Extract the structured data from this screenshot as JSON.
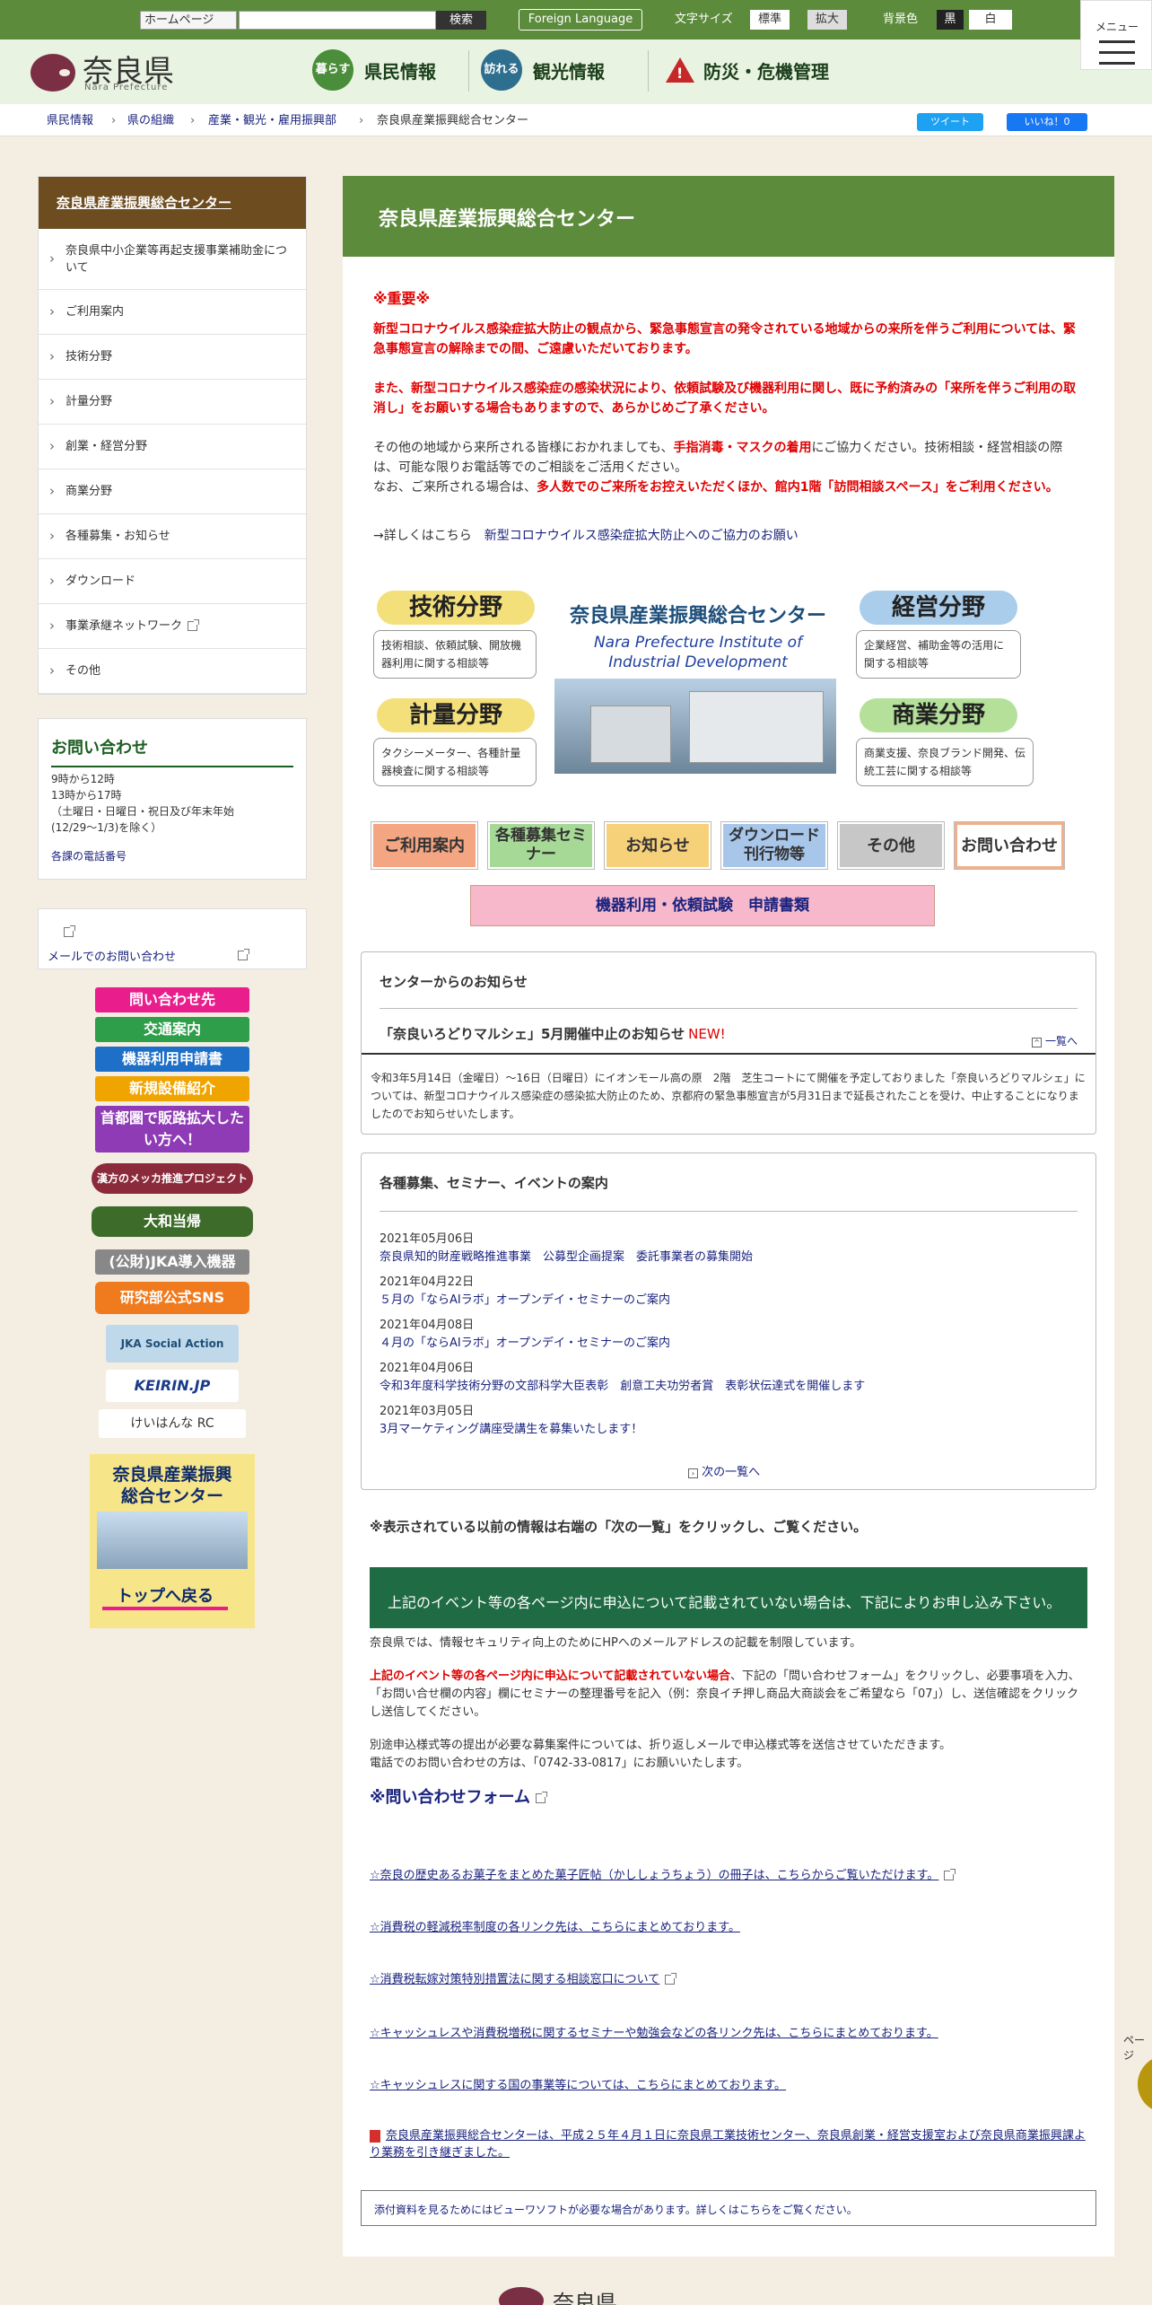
{
  "topbar": {
    "site_select": "ホームページ",
    "search_button": "検索",
    "foreign_language": "Foreign Language",
    "font_size_label": "文字サイズ",
    "font_standard": "標準",
    "font_large": "拡大",
    "bg_label": "背景色",
    "bg_black": "黒",
    "bg_white": "白",
    "menu": "メニュー"
  },
  "header": {
    "logo": "奈良県",
    "logo_sub": "Nara Prefecture",
    "nav": [
      {
        "icon": "暮らす",
        "label": "県民情報"
      },
      {
        "icon": "訪れる",
        "label": "観光情報"
      },
      {
        "icon": "!",
        "label": "防災・危機管理"
      }
    ]
  },
  "breadcrumb": [
    "県民情報",
    "県の組織",
    "産業・観光・雇用振興部",
    "奈良県産業振興総合センター"
  ],
  "social": {
    "tweet": "ツイート",
    "like": "いいね！0"
  },
  "sidebar": {
    "title": "奈良県産業振興総合センター",
    "items": [
      "奈良県中小企業等再起支援事業補助金について",
      "ご利用案内",
      "技術分野",
      "計量分野",
      "創業・経営分野",
      "商業分野",
      "各種募集・お知らせ",
      "ダウンロード",
      "事業承継ネットワーク",
      "その他"
    ]
  },
  "contact": {
    "title": "お問い合わせ",
    "hours1": "9時から12時",
    "hours2": "13時から17時",
    "hours3": "（土曜日・日曜日・祝日及び年末年始",
    "hours4": "(12/29～1/3)を除く）",
    "phone_link": "各課の電話番号",
    "mail_link": "メールでのお問い合わせ"
  },
  "banners": [
    "問い合わせ先",
    "交通案内",
    "機器利用申請書",
    "新規設備紹介",
    "首都圏で販路拡大したい方へ！",
    "漢方のメッカ推進プロジェクト",
    "大和当帰",
    "(公財)JKA導入機器",
    "研究部公式SNS",
    "JKA Social Action",
    "KEIRIN.JP",
    "けいはんな RC"
  ],
  "top_banner": {
    "line1": "奈良県産業振興",
    "line2": "総合センター",
    "button": "トップへ戻る"
  },
  "main": {
    "title": "奈良県産業振興総合センター",
    "important": "※重要※",
    "notice1": "新型コロナウイルス感染症拡大防止の観点から、緊急事態宣言の発令されている地域からの来所を伴うご利用については、緊急事態宣言の解除までの間、ご遠慮いただいております。",
    "notice2": "また、新型コロナウイルス感染症の感染状況により、依頼試験及び機器利用に関し、既に予約済みの「来所を伴うご利用の取消し」をお願いする場合もありますので、あらかじめご了承ください。",
    "notice3a": "その他の地域から来所される皆様におかれましても、",
    "notice3b": "手指消毒・マスクの着用",
    "notice3c": "にご協力ください。技術相談・経営相談の際は、可能な限りお電話等でのご相談をご活用ください。",
    "notice4a": "なお、ご来所される場合は、",
    "notice4b": "多人数でのご来所をお控えいただくほか、館内1階「訪問相談スペース」をご利用ください。",
    "more_prefix": "→詳しくはこちら",
    "more_link": "新型コロナウイルス感染症拡大防止へのご協力のお願い"
  },
  "fields": {
    "tech": {
      "title": "技術分野",
      "desc": "技術相談、依頼試験、開放機器利用に関する相談等"
    },
    "mgmt": {
      "title": "経営分野",
      "desc": "企業経営、補助金等の活用に関する相談等"
    },
    "meas": {
      "title": "計量分野",
      "desc": "タクシーメーター、各種計量器検査に関する相談等"
    },
    "comm": {
      "title": "商業分野",
      "desc": "商業支援、奈良ブランド開発、伝統工芸に関する相談等"
    },
    "center_jp": "奈良県産業振興総合センター",
    "center_en1": "Nara Prefecture Institute of",
    "center_en2": "Industrial Development"
  },
  "quicknav": [
    "ご利用案内",
    "各種募集セミナー",
    "お知らせ",
    "ダウンロード刊行物等",
    "その他",
    "お問い合わせ"
  ],
  "apply_button": "機器利用・依頼試験　申請書類",
  "news": {
    "title": "センターからのお知らせ",
    "item_title": "「奈良いろどりマルシェ」5月開催中止のお知らせ",
    "new": "NEW!",
    "list_link": "一覧へ",
    "body": "令和3年5月14日（金曜日）～16日（日曜日）にイオンモール高の原　2階　芝生コートにて開催を予定しておりました「奈良いろどりマルシェ」については、新型コロナウイルス感染症の感染拡大防止のため、京都府の緊急事態宣言が5月31日まで延長されたことを受け、中止することになりましたのでお知らせいたします。"
  },
  "events": {
    "title": "各種募集、セミナー、イベントの案内",
    "items": [
      {
        "date": "2021年05月06日",
        "text": "奈良県知的財産戦略推進事業　公募型企画提案　委託事業者の募集開始"
      },
      {
        "date": "2021年04月22日",
        "text": "５月の「ならAIラボ」オープンデイ・セミナーのご案内"
      },
      {
        "date": "2021年04月08日",
        "text": "４月の「ならAIラボ」オープンデイ・セミナーのご案内"
      },
      {
        "date": "2021年04月06日",
        "text": "令和3年度科学技術分野の文部科学大臣表彰　創意工夫功労者賞　表彰状伝達式を開催します"
      },
      {
        "date": "2021年03月05日",
        "text": "3月マーケティング講座受講生を募集いたします！"
      }
    ],
    "next_link": "次の一覧へ"
  },
  "note_prev": "※表示されている以前の情報は右端の「次の一覧」をクリックし、ご覧ください。",
  "apply_info": {
    "banner": "上記のイベント等の各ページ内に申込について記載されていない場合は、下記によりお申し込み下さい。",
    "p1": "奈良県では、情報セキュリティ向上のためにHPへのメールアドレスの記載を制限しています。",
    "p2a": "上記のイベント等の各ページ内に申込について記載されていない場合",
    "p2b": "、下記の「問い合わせフォーム」をクリックし、必要事項を入力、「お問い合せ欄の内容」欄にセミナーの整理番号を記入（例：奈良イチ押し商品大商談会をご希望なら「07」）し、送信確認をクリックし送信してください。",
    "p3": "別途申込様式等の提出が必要な募集案件については、折り返しメールで申込様式等を送信させていただきます。",
    "p4": "電話でのお問い合わせの方は、「0742-33-0817」にお願いいたします。",
    "form_link": "※問い合わせフォーム"
  },
  "links": [
    "☆奈良の歴史あるお菓子をまとめた菓子匠帖（かししょうちょう）の冊子は、こちらからご覧いただけます。",
    "☆消費税の軽減税率制度の各リンク先は、こちらにまとめております。",
    "☆消費税転嫁対策特別措置法に関する相談窓口について",
    "☆キャッシュレスや消費税増税に関するセミナーや勉強会などの各リンク先は、こちらにまとめております。",
    "☆キャッシュレスに関する国の事業等については、こちらにまとめております。",
    "奈良県産業振興総合センターは、平成２５年４月１日に奈良県工業技術センター、奈良県創業・経営支援室および奈良県商業振興課より業務を引き継ぎました。"
  ],
  "viewer_note": "添付資料を見るためにはビューワソフトが必要な場合があります。詳しくはこちらをご覧ください。",
  "page_top": "ページ",
  "footer_logo": "奈良県"
}
